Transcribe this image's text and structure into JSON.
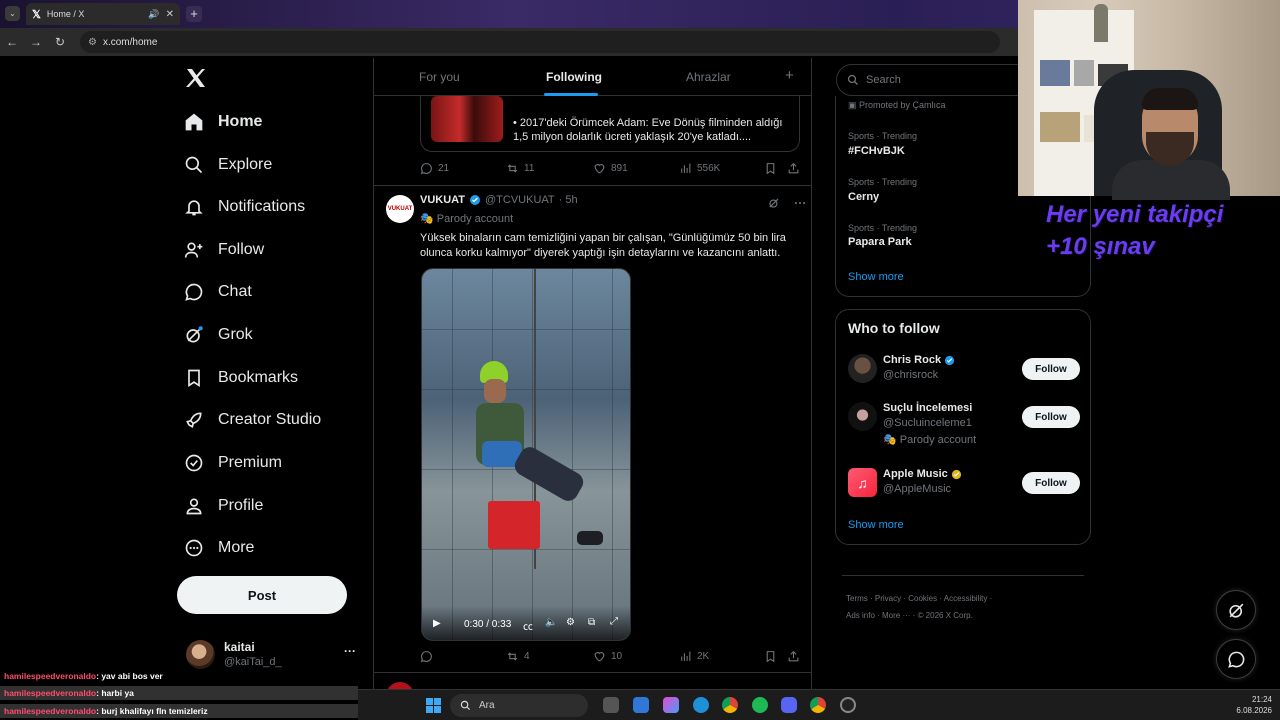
{
  "browser": {
    "tab_title": "Home / X",
    "url": "x.com/home"
  },
  "nav": {
    "items": [
      {
        "label": "Home",
        "icon": "home-icon"
      },
      {
        "label": "Explore",
        "icon": "search-icon"
      },
      {
        "label": "Notifications",
        "icon": "bell-icon"
      },
      {
        "label": "Follow",
        "icon": "person-add-icon"
      },
      {
        "label": "Chat",
        "icon": "chat-icon"
      },
      {
        "label": "Grok",
        "icon": "grok-icon"
      },
      {
        "label": "Bookmarks",
        "icon": "bookmark-icon"
      },
      {
        "label": "Creator Studio",
        "icon": "rocket-icon"
      },
      {
        "label": "Premium",
        "icon": "verified-badge-icon"
      },
      {
        "label": "Profile",
        "icon": "person-icon"
      },
      {
        "label": "More",
        "icon": "more-circle-icon"
      }
    ],
    "post_label": "Post",
    "account": {
      "name": "kaitai",
      "handle": "@kaiTai_d_",
      "menu": "···"
    }
  },
  "feed": {
    "tabs": [
      "For you",
      "Following",
      "Ahrazlar"
    ],
    "add_tab": "+",
    "prev_post": {
      "quote_text": "• 2017'deki Örümcek Adam: Eve Dönüş filminden aldığı 1,5 milyon dolarlık ücreti yaklaşık 20'ye katladı....",
      "replies": "21",
      "reposts": "11",
      "likes": "891",
      "views": "556K"
    },
    "tweet": {
      "name": "VUKUAT",
      "handle": "@TCVUKUAT",
      "time": "· 5h",
      "avatar_text": "VUKUAT",
      "parody": "Parody account",
      "text": "Yüksek binaların cam temizliğini yapan bir çalışan, \"Günlüğümüz 50 bin lira olunca korku kalmıyor\" diyerek yaptığı işin detaylarını ve kazancını anlattı.",
      "video_time": "0:30 / 0:33",
      "replies": "",
      "reposts": "4",
      "likes": "10",
      "views": "2K"
    }
  },
  "sidebar": {
    "search_placeholder": "Search",
    "promoted": "Promoted by Çamlıca",
    "trends": [
      {
        "meta": "Sports · Trending",
        "name": "#FCHvBJK"
      },
      {
        "meta": "Sports · Trending",
        "name": "Cerny"
      },
      {
        "meta": "Sports · Trending",
        "name": "Papara Park"
      }
    ],
    "show_more": "Show more",
    "who_to_follow": {
      "title": "Who to follow",
      "users": [
        {
          "name": "Chris Rock",
          "handle": "@chrisrock",
          "badge": "blue",
          "extra": ""
        },
        {
          "name": "Suçlu İncelemesi",
          "handle": "@Sucluinceleme1",
          "badge": "",
          "extra": "Parody account"
        },
        {
          "name": "Apple Music",
          "handle": "@AppleMusic",
          "badge": "gold",
          "extra": ""
        }
      ],
      "follow_label": "Follow",
      "show_more": "Show more"
    },
    "footer": {
      "line1": "Terms · Privacy · Cookies · Accessibility ·",
      "line2": "Ads info · More ··· · © 2026 X Corp."
    }
  },
  "stream": {
    "overlay_text_1": "Her yeni takipçi",
    "overlay_text_2": "+10 şınav",
    "chat": [
      {
        "user": "hamilespeedveronaldo",
        "msg": ": yav abi bos ver"
      },
      {
        "user": "hamilespeedveronaldo",
        "msg": ": harbi ya"
      },
      {
        "user": "hamilespeedveronaldo",
        "msg": ": burj khalifayı fln temizleriz"
      }
    ]
  },
  "taskbar": {
    "search_label": "Ara",
    "time": "21:24",
    "date": "6.08.2026"
  },
  "colors": {
    "accent": "#1d9bf0",
    "background": "#000000",
    "border": "#2f3336",
    "muted": "#71767b",
    "overlay_purple": "#6a3df0"
  }
}
